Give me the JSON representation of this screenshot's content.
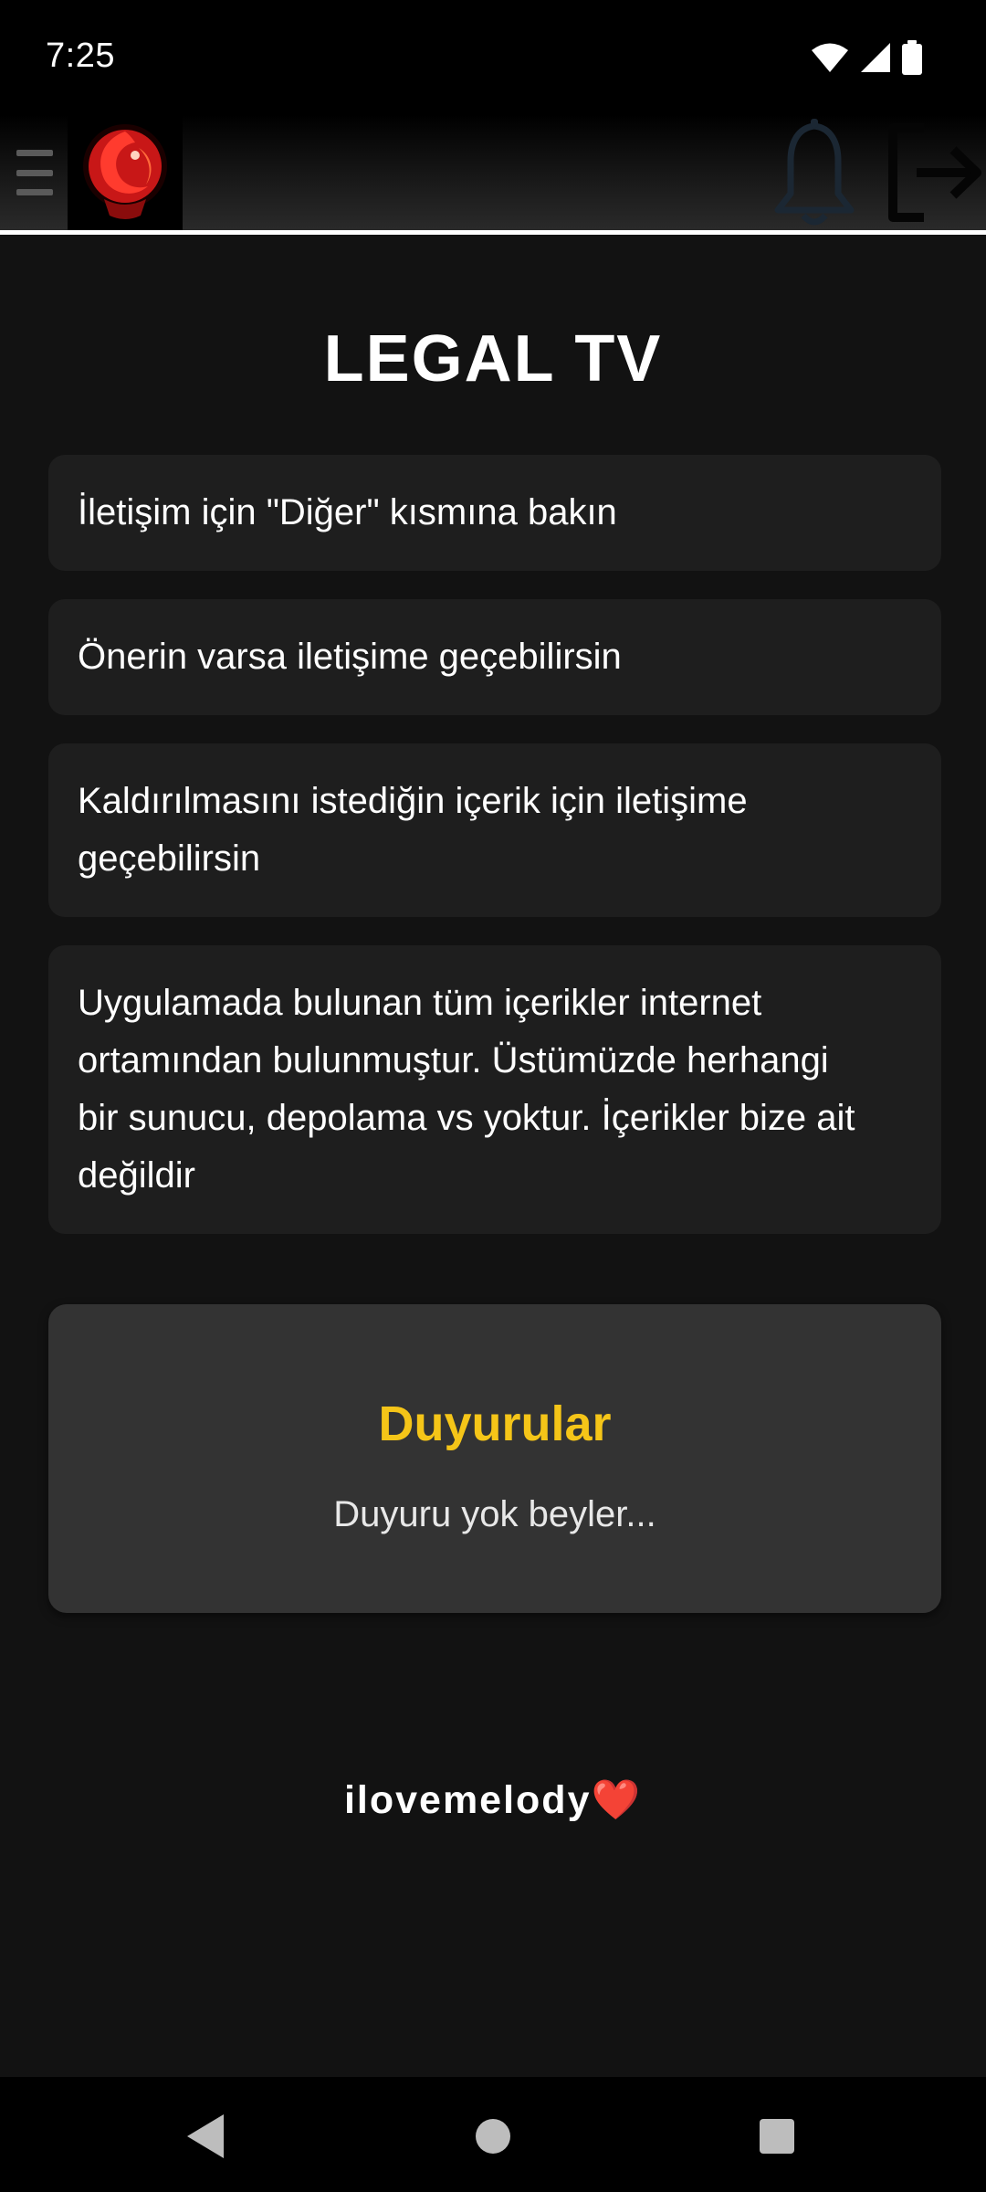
{
  "status_bar": {
    "time": "7:25",
    "icons": [
      "wifi-icon",
      "cell-signal-icon",
      "battery-icon"
    ]
  },
  "header": {
    "menu_icon": "hamburger-menu-icon",
    "logo": "phoenix-logo",
    "notification_icon": "bell-icon",
    "logout_icon": "logout-icon"
  },
  "main": {
    "title": "LEGAL TV",
    "cards": [
      {
        "lines": [
          "İletişim için \"Diğer\" kısmına bakın"
        ]
      },
      {
        "lines": [
          "Önerin varsa iletişime geçebilirsin"
        ]
      },
      {
        "lines": [
          "Kaldırılmasını istediğin içerik için iletişime",
          "geçebilirsin"
        ]
      },
      {
        "lines": [
          "Uygulamada bulunan tüm içerikler internet",
          "ortamından bulunmuştur. Üstümüzde herhangi",
          "bir sunucu, depolama vs yoktur. İçerikler bize ait",
          "değildir"
        ]
      }
    ],
    "announcements": {
      "title": "Duyurular",
      "text": "Duyuru yok beyler..."
    },
    "footer": {
      "text": "ilovemelody",
      "heart": "❤️"
    }
  },
  "colors": {
    "background": "#121212",
    "card": "#1e1e1e",
    "announce_card": "#333333",
    "accent": "#f5c518",
    "logo_red": "#d81e1e"
  },
  "nav_bar": {
    "icons": [
      "back-icon",
      "home-icon",
      "recents-icon"
    ]
  }
}
